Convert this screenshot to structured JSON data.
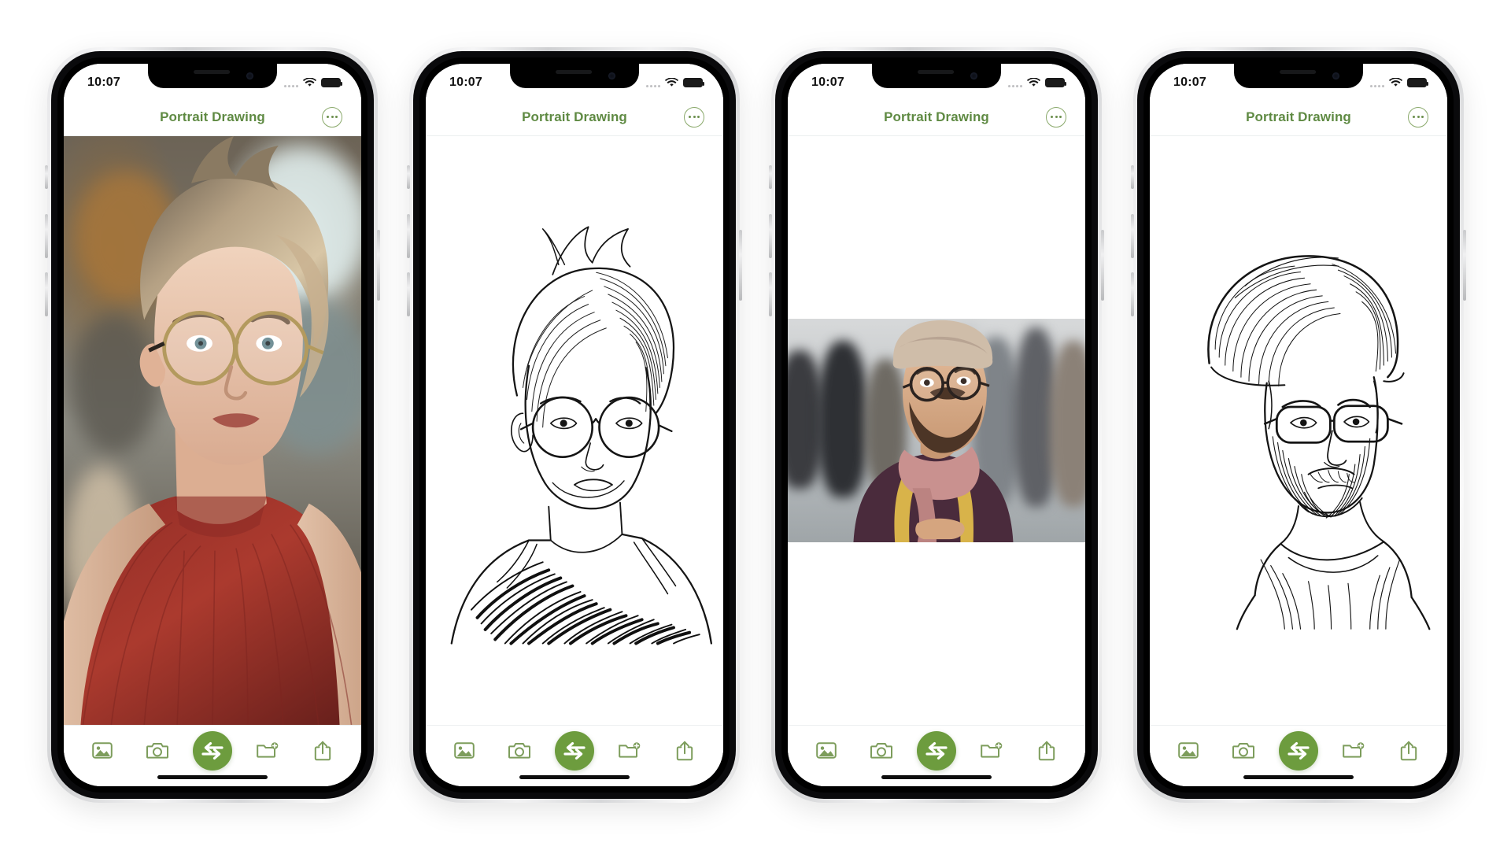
{
  "app": {
    "name": "Portrait Drawing",
    "accent_green": "#6d9c3e",
    "title_green": "#5f8a43",
    "icon_outline_green": "#7d9d5c"
  },
  "status_bar": {
    "time": "10:07",
    "signal_icon": "cellular-signal-icon",
    "wifi_icon": "wifi-icon",
    "battery_icon": "battery-full-icon"
  },
  "nav_bar": {
    "title": "Portrait Drawing",
    "more_button": {
      "label": "More options",
      "icon": "ellipsis-circle-icon"
    }
  },
  "toolbar": {
    "items": [
      {
        "name": "photo-library-button",
        "label": "Photo Library",
        "icon": "photo-icon"
      },
      {
        "name": "camera-button",
        "label": "Camera",
        "icon": "camera-icon"
      },
      {
        "name": "convert-button",
        "label": "Convert",
        "icon": "swap-arrows-icon"
      },
      {
        "name": "save-to-folder-button",
        "label": "Save to Folder",
        "icon": "folder-plus-icon"
      },
      {
        "name": "share-button",
        "label": "Share",
        "icon": "share-up-arrow-icon"
      }
    ]
  },
  "screens": [
    {
      "id": "screen-1",
      "content_name": "source-photo-woman",
      "content_type": "photo",
      "content_description": "Color portrait photo of a woman with short blonde hair, round glasses and a red knit sweater on a blurred street background",
      "layout": "full"
    },
    {
      "id": "screen-2",
      "content_name": "sketch-result-woman",
      "content_type": "sketch",
      "content_description": "Black and white pencil line drawing of the woman with short hair, round glasses and a striped top",
      "layout": "tall"
    },
    {
      "id": "screen-3",
      "content_name": "source-photo-man",
      "content_type": "photo",
      "content_description": "Color street photo of a man in a hat, glasses, scarf and yellow backpack straps with a blurred crowd behind him",
      "layout": "band"
    },
    {
      "id": "screen-4",
      "content_name": "sketch-result-man",
      "content_type": "sketch",
      "content_description": "Black and white pencil line drawing of the bearded man with a hat, glasses and scarf",
      "layout": "sketch"
    }
  ]
}
